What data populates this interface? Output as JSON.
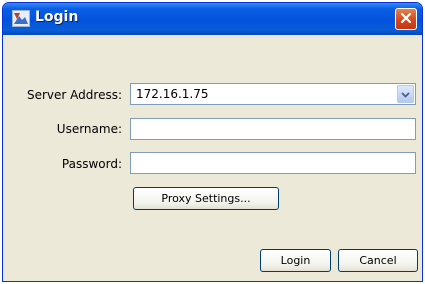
{
  "window": {
    "title": "Login",
    "icon": "app-icon",
    "close_icon": "close-icon"
  },
  "form": {
    "server_label": "Server Address:",
    "server_value": "172.16.1.75",
    "username_label": "Username:",
    "username_value": "",
    "password_label": "Password:",
    "password_value": ""
  },
  "buttons": {
    "proxy": "Proxy Settings...",
    "login": "Login",
    "cancel": "Cancel"
  },
  "colors": {
    "titlebar": "#0452dc",
    "close_button": "#d2451e",
    "dialog_background": "#ece9d8",
    "field_border": "#7f9db9"
  }
}
